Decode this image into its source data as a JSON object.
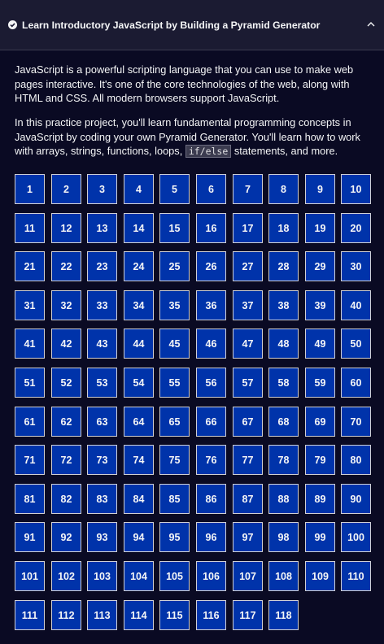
{
  "block": {
    "title": "Learn Introductory JavaScript by Building a Pyramid Generator",
    "status_icon": "check-circle-icon",
    "toggle_icon": "chevron-up-icon",
    "description": {
      "paragraph1": "JavaScript is a powerful scripting language that you can use to make web pages interactive. It's one of the core technologies of the web, along with HTML and CSS. All modern browsers support JavaScript.",
      "paragraph2_before": "In this practice project, you'll learn fundamental programming concepts in JavaScript by coding your own Pyramid Generator. You'll learn how to work with arrays, strings, functions, loops, ",
      "paragraph2_code": "if/else",
      "paragraph2_after": " statements, and more."
    },
    "steps": [
      "1",
      "2",
      "3",
      "4",
      "5",
      "6",
      "7",
      "8",
      "9",
      "10",
      "11",
      "12",
      "13",
      "14",
      "15",
      "16",
      "17",
      "18",
      "19",
      "20",
      "21",
      "22",
      "23",
      "24",
      "25",
      "26",
      "27",
      "28",
      "29",
      "30",
      "31",
      "32",
      "33",
      "34",
      "35",
      "36",
      "37",
      "38",
      "39",
      "40",
      "41",
      "42",
      "43",
      "44",
      "45",
      "46",
      "47",
      "48",
      "49",
      "50",
      "51",
      "52",
      "53",
      "54",
      "55",
      "56",
      "57",
      "58",
      "59",
      "60",
      "61",
      "62",
      "63",
      "64",
      "65",
      "66",
      "67",
      "68",
      "69",
      "70",
      "71",
      "72",
      "73",
      "74",
      "75",
      "76",
      "77",
      "78",
      "79",
      "80",
      "81",
      "82",
      "83",
      "84",
      "85",
      "86",
      "87",
      "88",
      "89",
      "90",
      "91",
      "92",
      "93",
      "94",
      "95",
      "96",
      "97",
      "98",
      "99",
      "100",
      "101",
      "102",
      "103",
      "104",
      "105",
      "106",
      "107",
      "108",
      "109",
      "110",
      "111",
      "112",
      "113",
      "114",
      "115",
      "116",
      "117",
      "118"
    ]
  },
  "colors": {
    "background": "#0a0a23",
    "header_background": "#1b1b32",
    "step_fill": "#0033aa",
    "step_border": "#d0d0d5",
    "text": "#f5f6f7"
  }
}
